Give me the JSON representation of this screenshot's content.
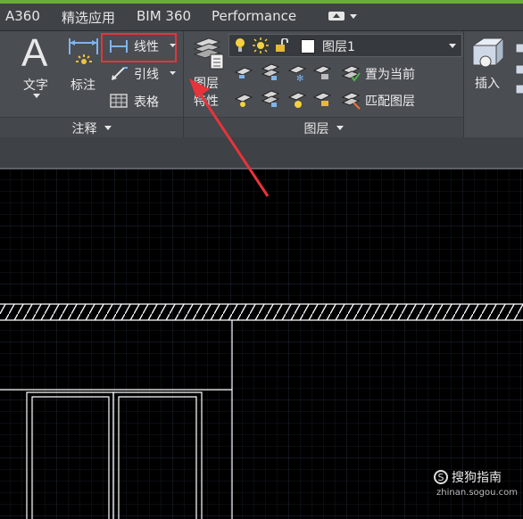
{
  "tabs": [
    {
      "label": "A360"
    },
    {
      "label": "精选应用"
    },
    {
      "label": "BIM 360"
    },
    {
      "label": "Performance"
    }
  ],
  "annotation_panel": {
    "title": "注释",
    "text_tool": {
      "label": "文字",
      "glyph": "A"
    },
    "dim_tool": {
      "label": "标注"
    },
    "linear": {
      "label": "线性"
    },
    "leader": {
      "label": "引线"
    },
    "table": {
      "label": "表格"
    }
  },
  "layers_panel": {
    "title": "图层",
    "properties": {
      "label_line1": "图层",
      "label_line2": "特性"
    },
    "current_layer": "图层1",
    "set_current": {
      "label": "置为当前"
    },
    "match_layer": {
      "label": "匹配图层"
    }
  },
  "insert": {
    "label": "插入"
  },
  "watermark": {
    "brand": "搜狗指南",
    "url": "zhinan.sogou.com"
  },
  "colors": {
    "highlight_box": "#e8333a",
    "arrow": "#e8333a",
    "ribbon_bg": "#4a4d52",
    "canvas_bg": "#000000",
    "grid": "#1f2430",
    "drawing_lines": "#ffffff"
  }
}
